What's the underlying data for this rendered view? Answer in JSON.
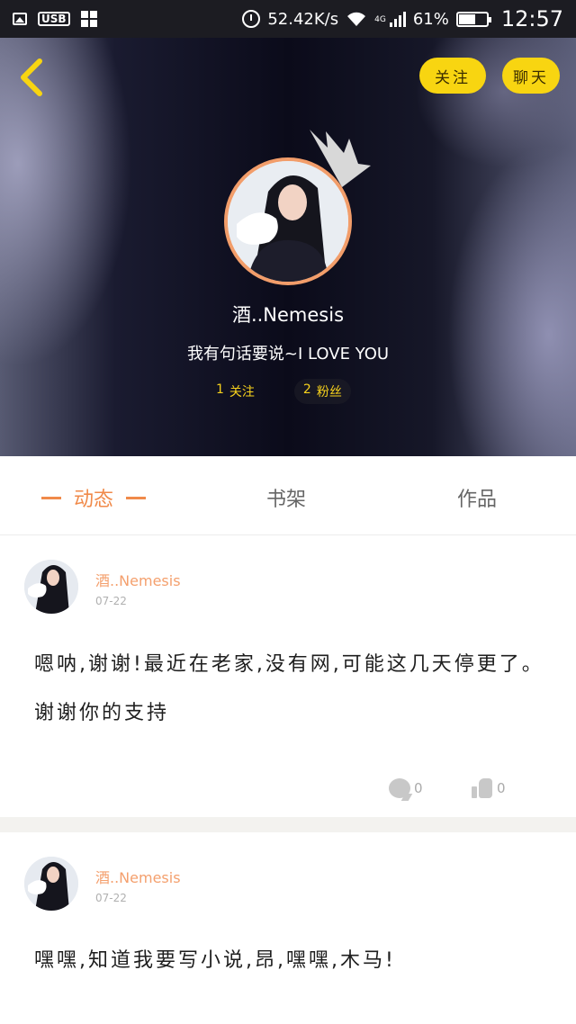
{
  "status_bar": {
    "speed": "52.42K/s",
    "network": "4G",
    "battery": "61%",
    "time": "12:57"
  },
  "header": {
    "follow_button": "关注",
    "chat_button": "聊天",
    "username": "酒..Nemesis",
    "bio": "我有句话要说~I LOVE YOU",
    "following_count": "1",
    "following_label": "关注",
    "fans_count": "2",
    "fans_label": "粉丝",
    "colors": {
      "accent_yellow": "#f8d511",
      "avatar_ring": "#f29d6a"
    }
  },
  "tabs": [
    {
      "label": "动态",
      "active": true
    },
    {
      "label": "书架",
      "active": false
    },
    {
      "label": "作品",
      "active": false
    }
  ],
  "posts": [
    {
      "author": "酒..Nemesis",
      "date": "07-22",
      "text": "嗯呐,谢谢!最近在老家,没有网,可能这几天停更了。谢谢你的支持",
      "comments": "0",
      "likes": "0"
    },
    {
      "author": "酒..Nemesis",
      "date": "07-22",
      "text": "嘿嘿,知道我要写小说,昂,嘿嘿,木马!"
    }
  ],
  "accent_color": "#f08a4a"
}
